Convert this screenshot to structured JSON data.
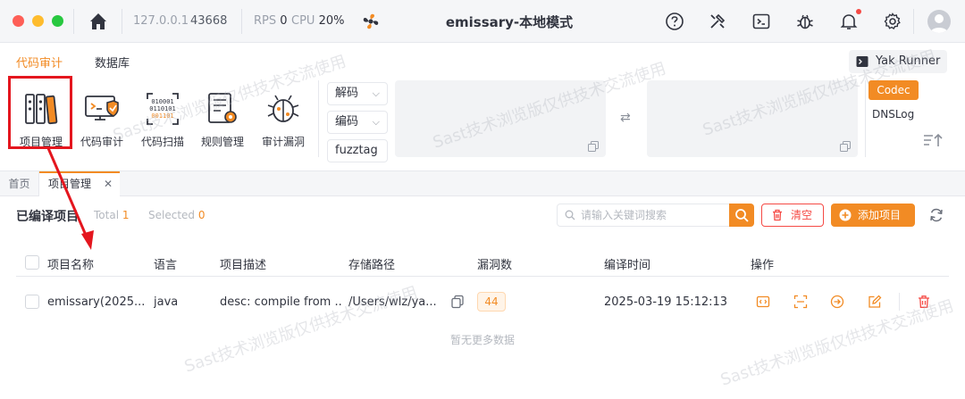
{
  "titlebar": {
    "address": "127.0.0.1",
    "port": "43668",
    "rps_label": "RPS",
    "rps_value": "0",
    "cpu_label": "CPU",
    "cpu_value": "20%",
    "title": "emissary-本地模式"
  },
  "toolbar": {
    "tabs": [
      "代码审计",
      "数据库"
    ],
    "tools": [
      {
        "label": "项目管理",
        "icon": "project-manage-icon"
      },
      {
        "label": "代码审计",
        "icon": "code-audit-icon"
      },
      {
        "label": "代码扫描",
        "icon": "code-scan-icon"
      },
      {
        "label": "规则管理",
        "icon": "rule-manage-icon"
      },
      {
        "label": "审计漏洞",
        "icon": "audit-vuln-icon"
      }
    ],
    "decode_label": "解码",
    "encode_label": "编码",
    "fuzztag_label": "fuzztag",
    "yak_runner_label": "Yak Runner",
    "codec_label": "Codec",
    "dnslog_label": "DNSLog"
  },
  "page_tabs": {
    "home": "首页",
    "current": "项目管理"
  },
  "content": {
    "title": "已编译项目",
    "total_label": "Total",
    "total_value": "1",
    "selected_label": "Selected",
    "selected_value": "0",
    "search_placeholder": "请输入关键词搜索",
    "clear_label": "清空",
    "add_label": "添加项目",
    "columns": [
      "项目名称",
      "语言",
      "项目描述",
      "存储路径",
      "漏洞数",
      "编译时间",
      "操作"
    ],
    "rows": [
      {
        "name": "emissary(2025...",
        "language": "java",
        "description": "desc: compile from ...",
        "path": "/Users/wlz/ya...",
        "vulns": "44",
        "compiled_at": "2025-03-19 15:12:13"
      }
    ],
    "no_more": "暂无更多数据"
  },
  "watermark": "Sast技术浏览版仅供技术交流使用",
  "colors": {
    "accent": "#f28b24",
    "danger": "#f54a45",
    "highlight": "#e4161e"
  }
}
